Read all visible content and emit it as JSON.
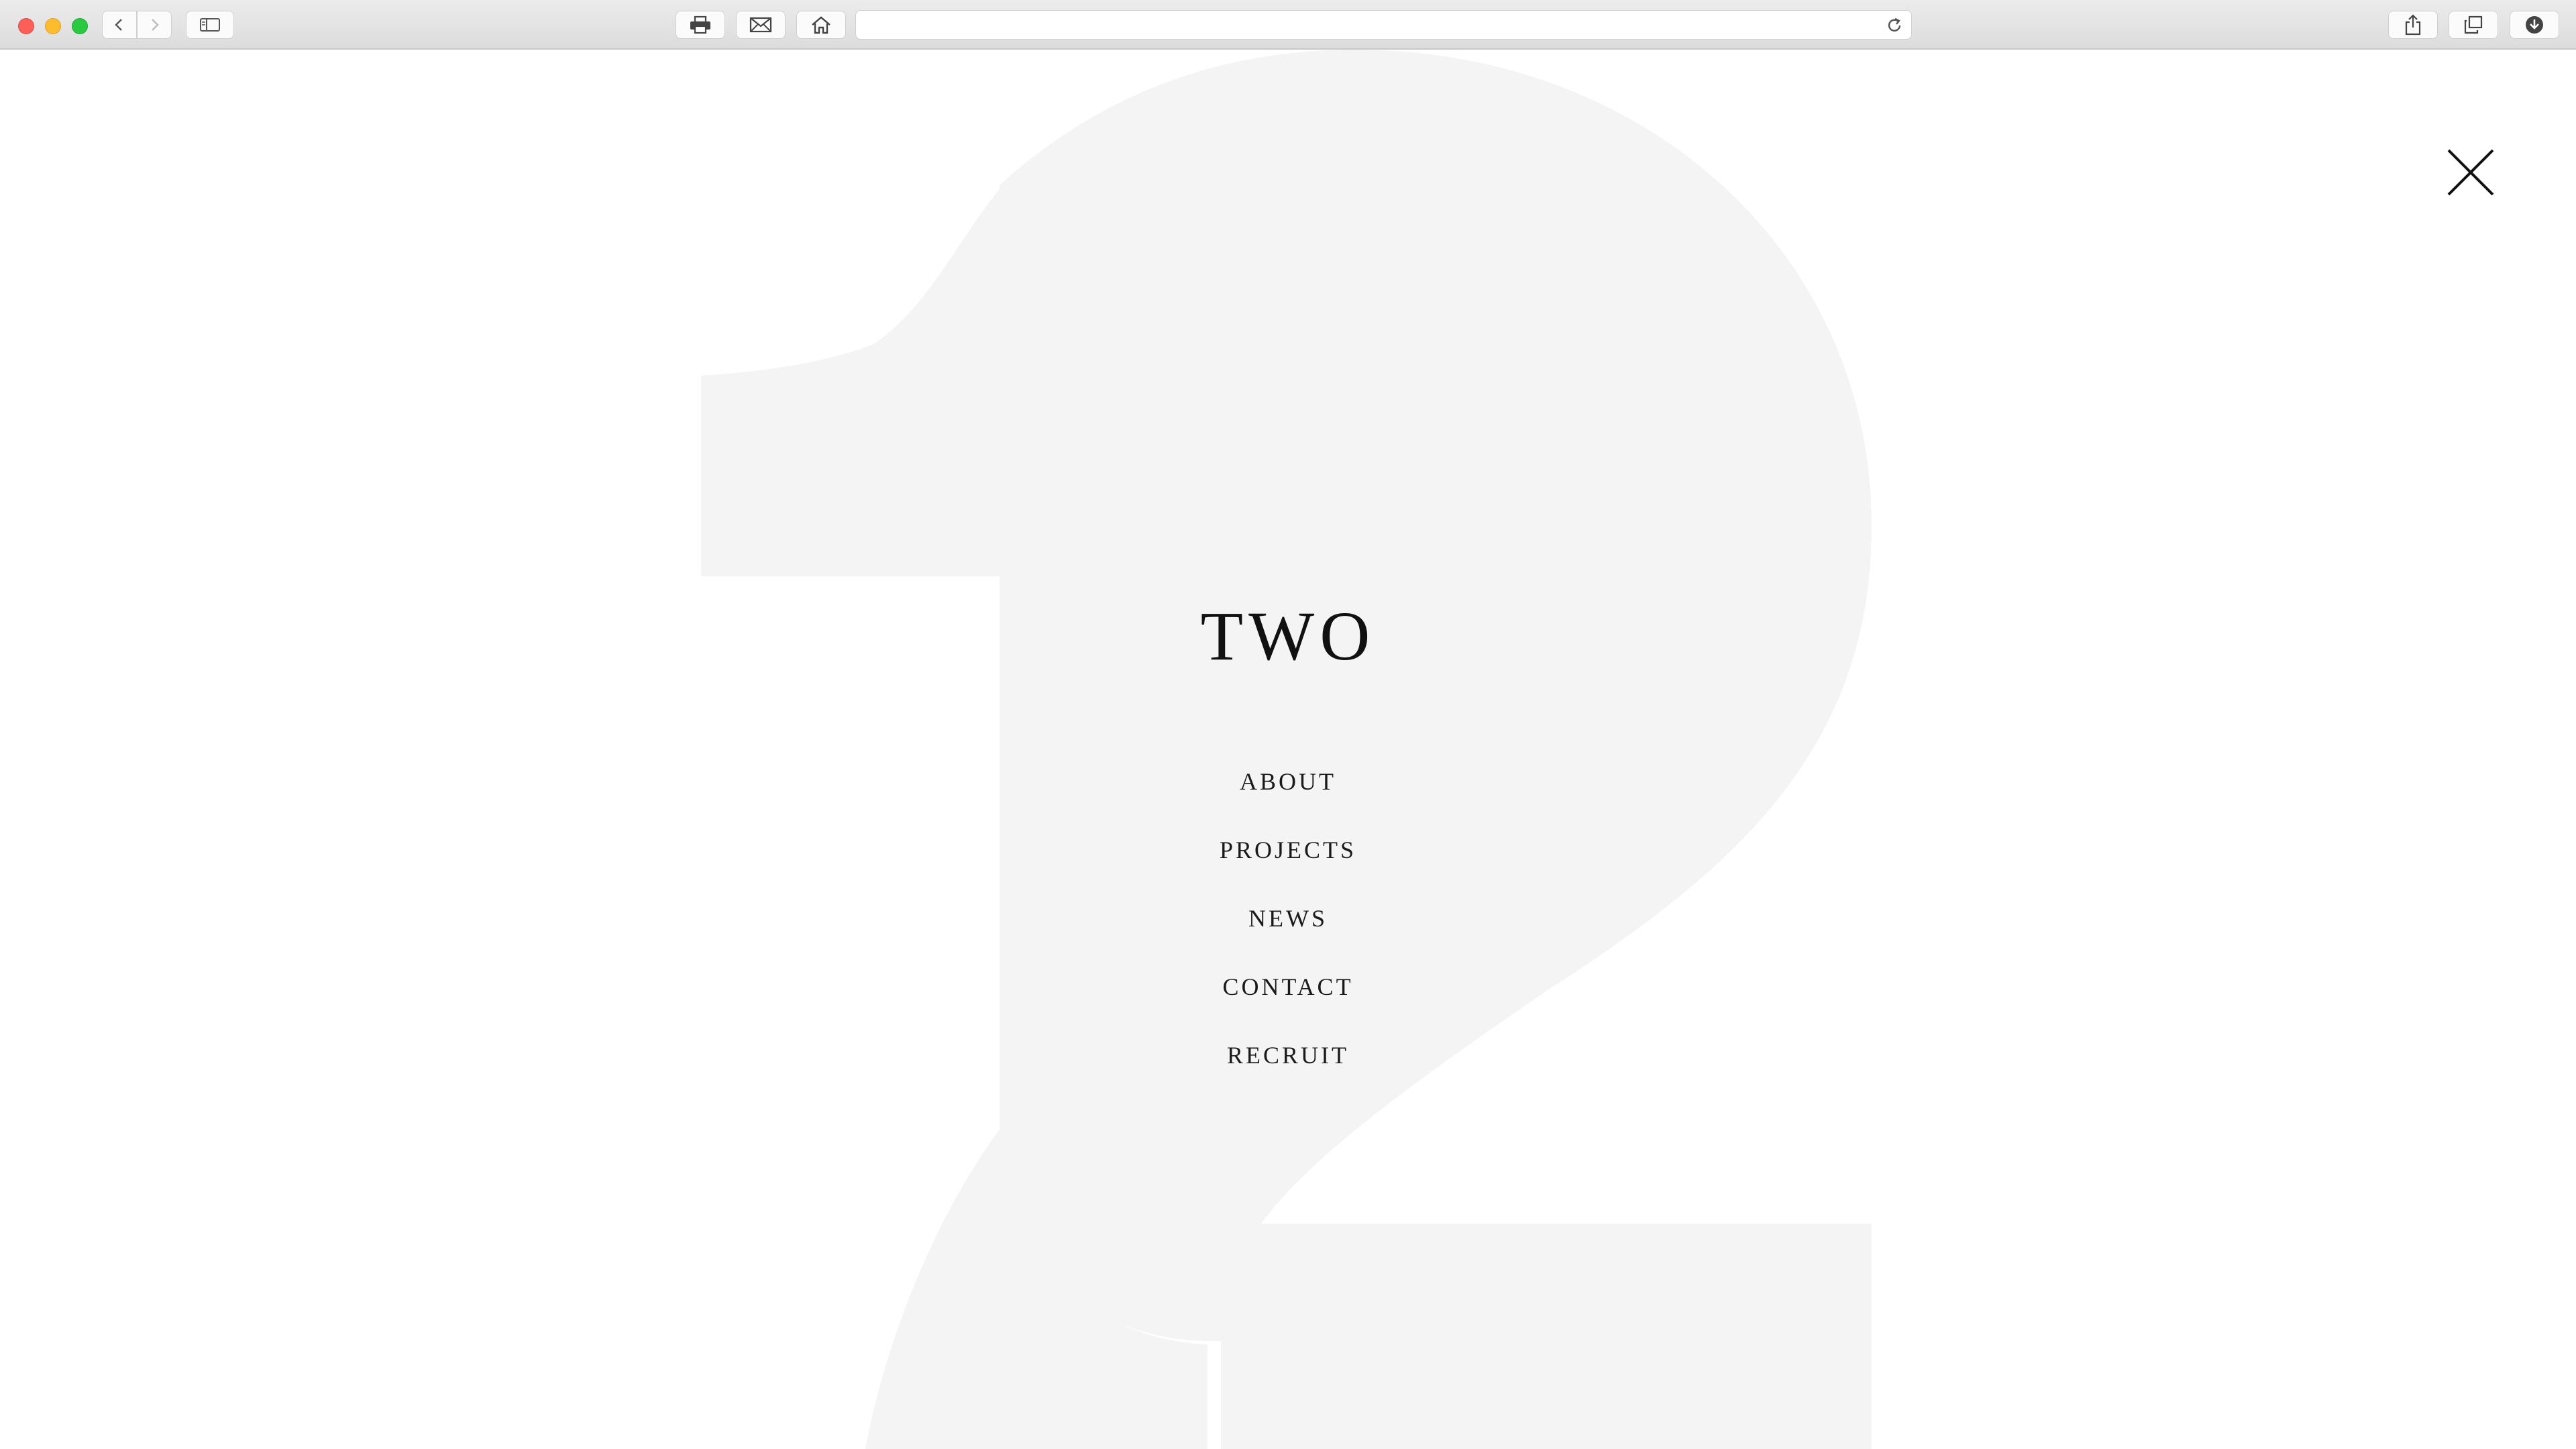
{
  "browser": {
    "buttons": [
      "back-icon",
      "forward-icon",
      "sidebar-icon",
      "print-icon",
      "mail-icon",
      "home-icon",
      "reload-icon",
      "share-icon",
      "tabs-icon",
      "downloads-icon"
    ],
    "address": ""
  },
  "site": {
    "logo": "TWO",
    "nav": [
      {
        "label": "ABOUT"
      },
      {
        "label": "PROJECTS"
      },
      {
        "label": "NEWS"
      },
      {
        "label": "CONTACT"
      },
      {
        "label": "RECRUIT"
      }
    ]
  },
  "colors": {
    "background": "#ffffff",
    "numeral": "#f4f4f4",
    "text": "#1a1a1a"
  }
}
